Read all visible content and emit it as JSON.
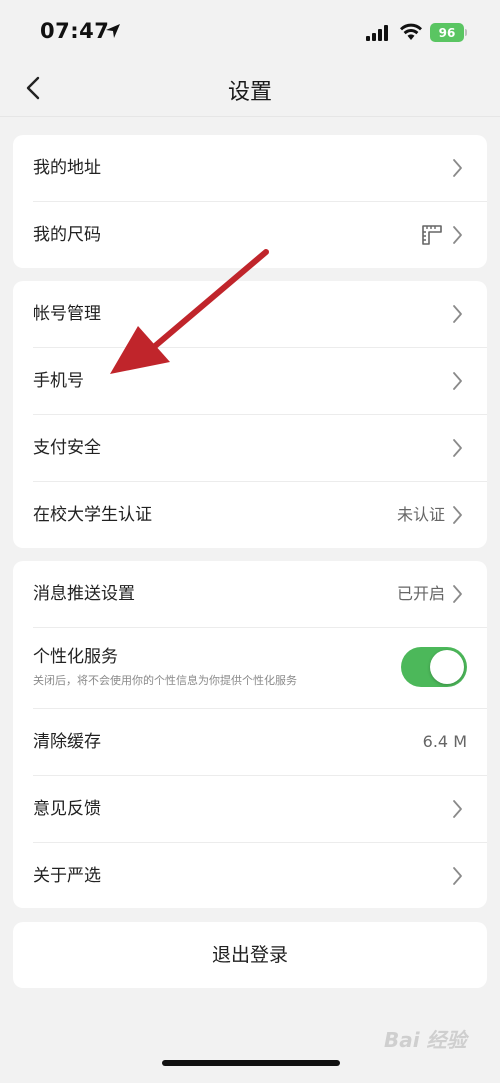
{
  "status_bar": {
    "time": "07:47",
    "battery": "96"
  },
  "nav": {
    "title": "设置"
  },
  "group1": {
    "items": [
      {
        "label": "我的地址"
      },
      {
        "label": "我的尺码"
      }
    ]
  },
  "group2": {
    "items": [
      {
        "label": "帐号管理"
      },
      {
        "label": "手机号"
      },
      {
        "label": "支付安全"
      },
      {
        "label": "在校大学生认证",
        "value": "未认证"
      }
    ]
  },
  "group3": {
    "items": [
      {
        "label": "消息推送设置",
        "value": "已开启"
      },
      {
        "label": "个性化服务",
        "desc": "关闭后，将不会使用你的个性信息为你提供个性化服务",
        "toggle_on": true
      },
      {
        "label": "清除缓存",
        "value": "6.4 M"
      },
      {
        "label": "意见反馈"
      },
      {
        "label": "关于严选"
      }
    ]
  },
  "logout": {
    "label": "退出登录"
  },
  "annotation": {
    "arrow_color": "#c0252b"
  },
  "watermark": "Bai 经验",
  "colors": {
    "background": "#f2f2f2",
    "toggle_on": "#4cb85a",
    "battery": "#5ac562"
  }
}
